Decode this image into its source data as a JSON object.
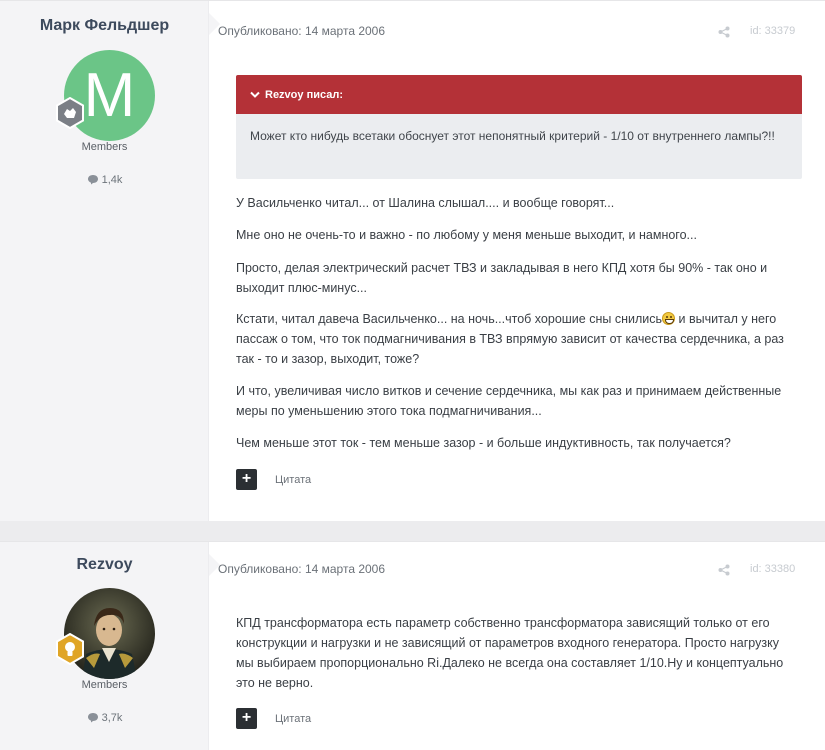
{
  "posts": [
    {
      "author": "Марк Фельдшер",
      "avatar_letter": "M",
      "avatar_color": "#6bc587",
      "group": "Members",
      "post_count": "1,4k",
      "published": "Опубликовано: 14 марта 2006",
      "id": "id: 33379",
      "quote": {
        "header": "Rezvoy писал:",
        "text": "Может кто нибудь всетаки обоснует этот непонятный критерий - 1/10 от внутреннего лампы?!!"
      },
      "paragraphs": [
        "У Васильченко читал... от Шалина слышал.... и вообще говорят...",
        "Мне оно не очень-то и важно - по любому у меня меньше выходит, и намного...",
        "Просто, делая электрический расчет ТВЗ и закладывая в него КПД хотя бы 90% - так оно и выходит плюс-минус...",
        "Кстати, читал давеча Васильченко... на ночь...чтоб хорошие сны снились",
        "и вычитал у него пассаж о том, что ток подмагничивания в ТВЗ впрямую зависит от качества сердечника, а раз так - то и зазор, выходит, тоже?",
        "И что, увеличивая число витков и сечение сердечника, мы как раз и принимаем действенные меры по уменьшению этого тока подмагничивания...",
        "Чем меньше этот ток - тем меньше зазор - и больше индуктивность, так получается?"
      ],
      "quote_label": "Цитата"
    },
    {
      "author": "Rezvoy",
      "group": "Members",
      "post_count": "3,7k",
      "published": "Опубликовано: 14 марта 2006",
      "id": "id: 33380",
      "paragraphs": [
        "КПД трансформатора есть параметр собственно трансформатора зависящий только от его конструкции и нагрузки и не зависящий от параметров входного генератора. Просто нагрузку мы выбираем пропорционально Ri.Далеко не всегда она составляет 1/10.Ну и концептуально это не верно."
      ],
      "quote_label": "Цитата"
    }
  ],
  "colors": {
    "quote_header": "#b43137",
    "author_name": "#3d4a5d",
    "badge_gold": "#e0a526"
  }
}
